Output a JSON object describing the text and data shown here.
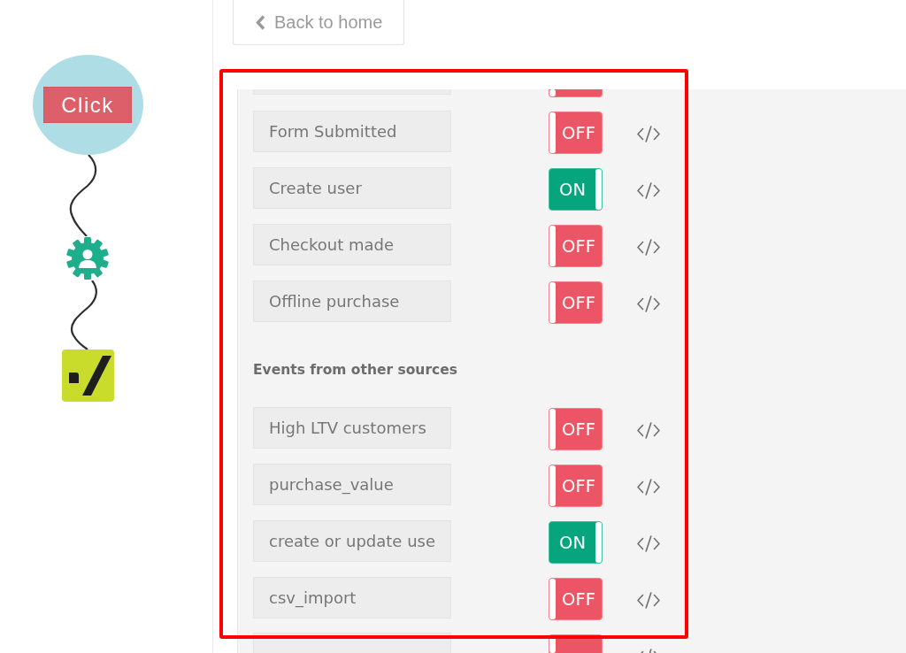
{
  "diagram": {
    "nodes": [
      {
        "kind": "trigger",
        "label": "Click"
      },
      {
        "kind": "action"
      },
      {
        "kind": "destination"
      }
    ]
  },
  "back_button": {
    "label": "Back to home"
  },
  "event_groups": [
    {
      "events": [
        {
          "kind": "cut_top",
          "on": false
        },
        {
          "kind": "event",
          "name": "Form Submitted",
          "on": false,
          "switch_text": "OFF"
        },
        {
          "kind": "event",
          "name": "Create user",
          "on": true,
          "switch_text": "ON"
        },
        {
          "kind": "event",
          "name": "Checkout made",
          "on": false,
          "switch_text": "OFF"
        },
        {
          "kind": "event",
          "name": "Offline purchase",
          "on": false,
          "switch_text": "OFF"
        }
      ]
    },
    {
      "heading": "Events from other sources",
      "events": [
        {
          "kind": "event",
          "name": "High LTV customers",
          "on": false,
          "switch_text": "OFF"
        },
        {
          "kind": "event",
          "name": "purchase_value",
          "on": false,
          "switch_text": "OFF"
        },
        {
          "kind": "event",
          "name": "create or update use",
          "on": true,
          "switch_text": "ON"
        },
        {
          "kind": "event",
          "name": "csv_import",
          "on": false,
          "switch_text": "OFF"
        },
        {
          "kind": "cut_bottom",
          "on": false
        }
      ]
    }
  ]
}
